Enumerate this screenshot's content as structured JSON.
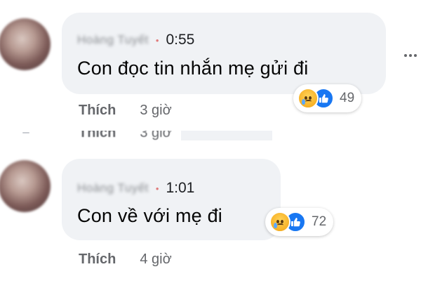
{
  "comments": [
    {
      "author": "Hoàng Tuyết",
      "duration": "0:55",
      "text": "Con đọc tin nhắn mẹ gửi đi",
      "reaction_count": "49",
      "like_label": "Thích",
      "time_ago": "3 giờ"
    },
    {
      "author": "Hoàng Tuyết",
      "duration": "1:01",
      "text": "Con về với mẹ đi",
      "reaction_count": "72",
      "like_label": "Thích",
      "time_ago": "4 giờ"
    }
  ],
  "partial": {
    "like_label": "Thích",
    "time_ago": "3 giờ"
  },
  "icons": {
    "reaction_1": "sad-icon",
    "reaction_2": "like-icon",
    "more": "more-options-icon"
  },
  "colors": {
    "bubble": "#f0f2f5",
    "like_blue": "#1877f2",
    "sad_yellow": "#f7b125",
    "meta_text": "#65676b"
  }
}
